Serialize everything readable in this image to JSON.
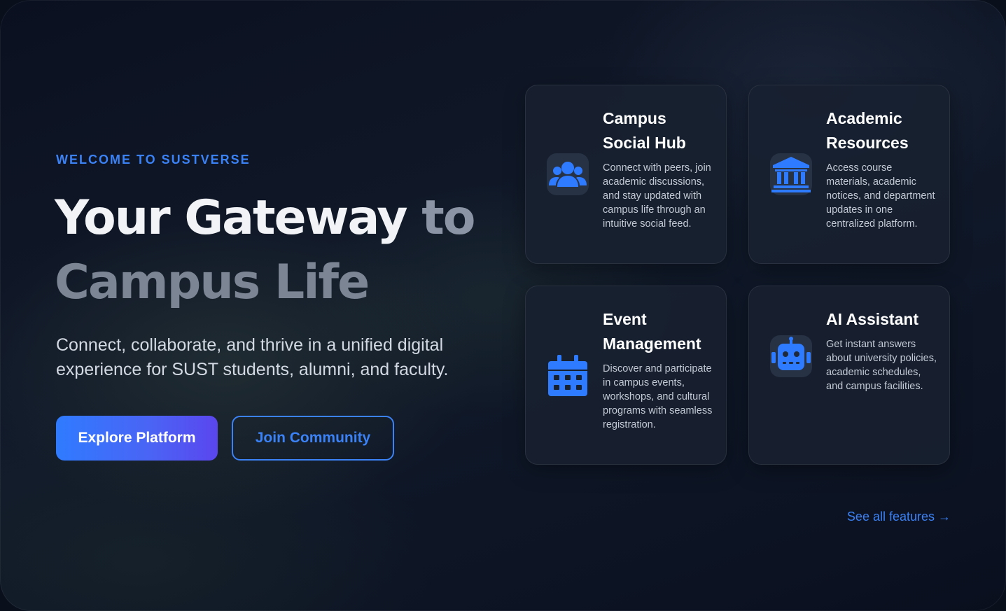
{
  "hero": {
    "eyebrow": "WELCOME TO SUSTVERSE",
    "title_line1_main": "Your Gateway",
    "title_line1_end": " to",
    "title_line2": "Campus Life",
    "subtitle": "Connect, collaborate, and thrive in a unified digital experience for SUST students, alumni, and faculty."
  },
  "buttons": {
    "primary_label": "Explore Platform",
    "secondary_label": "Join Community"
  },
  "features": [
    {
      "icon": "users-icon",
      "title": "Campus Social Hub",
      "description": "Connect with peers, join academic discussions, and stay updated with campus life through an intuitive social feed."
    },
    {
      "icon": "university-icon",
      "title": "Academic Resources",
      "description": "Access course materials, academic notices, and department updates in one centralized platform."
    },
    {
      "icon": "calendar-icon",
      "title": "Event Management",
      "description": "Discover and participate in campus events, workshops, and cultural programs with seamless registration."
    },
    {
      "icon": "robot-icon",
      "title": "AI Assistant",
      "description": "Get instant answers about university policies, academic schedules, and campus facilities."
    }
  ],
  "see_all_label": "See all features →",
  "colors": {
    "accent": "#3b82f6",
    "card_bg": "#182130",
    "icon_bg": "#273244",
    "gradient_start": "#2f7bff",
    "gradient_end": "#5a46ee"
  }
}
